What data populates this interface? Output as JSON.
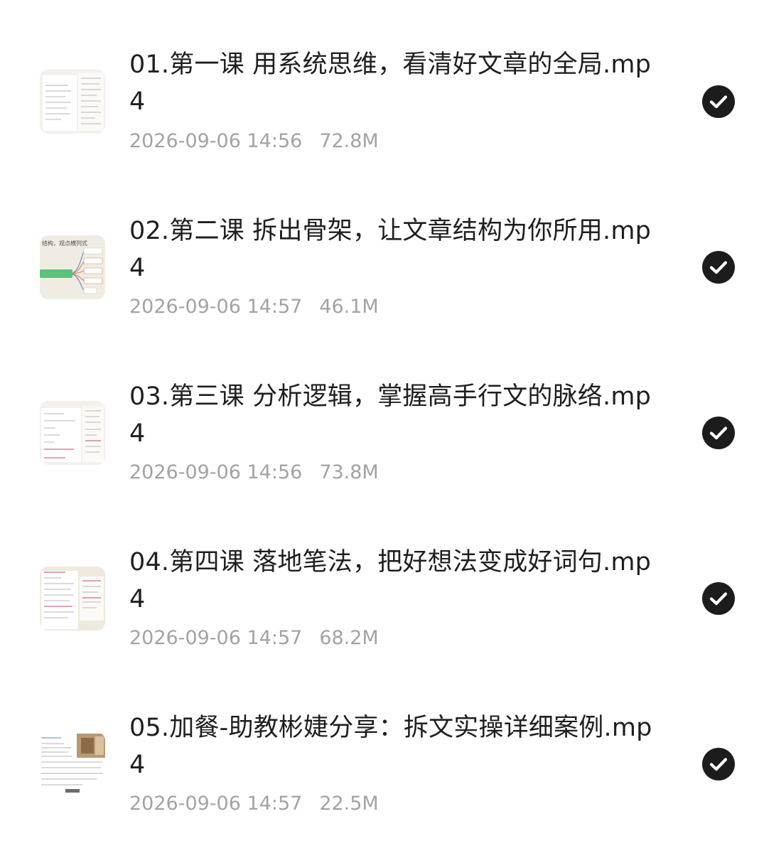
{
  "files": [
    {
      "title": "01.第一课 用系统思维，看清好文章的全局.mp4",
      "date": "2026-09-06 14:56",
      "size": "72.8M",
      "thumb_icon": "document-thumbnail",
      "selected_icon": "check-circle-icon"
    },
    {
      "title": "02.第二课 拆出骨架，让文章结构为你所用.mp4",
      "date": "2026-09-06 14:57",
      "size": "46.1M",
      "thumb_icon": "mindmap-thumbnail",
      "thumb_text": "结构，观点横列式",
      "selected_icon": "check-circle-icon"
    },
    {
      "title": "03.第三课 分析逻辑，掌握高手行文的脉络.mp4",
      "date": "2026-09-06 14:56",
      "size": "73.8M",
      "thumb_icon": "document-thumbnail",
      "selected_icon": "check-circle-icon"
    },
    {
      "title": "04.第四课 落地笔法，把好想法变成好词句.mp4",
      "date": "2026-09-06 14:57",
      "size": "68.2M",
      "thumb_icon": "document-thumbnail",
      "selected_icon": "check-circle-icon"
    },
    {
      "title": "05.加餐-助教彬婕分享：拆文实操详细案例.mp4",
      "date": "2026-09-06 14:57",
      "size": "22.5M",
      "thumb_icon": "document-photo-thumbnail",
      "selected_icon": "check-circle-icon"
    }
  ],
  "colors": {
    "title": "#1f1f1f",
    "meta": "#a3a3a3",
    "check_bg": "#1c1c1c",
    "check_mark": "#ffffff",
    "mindmap_green": "#5ec07a"
  }
}
